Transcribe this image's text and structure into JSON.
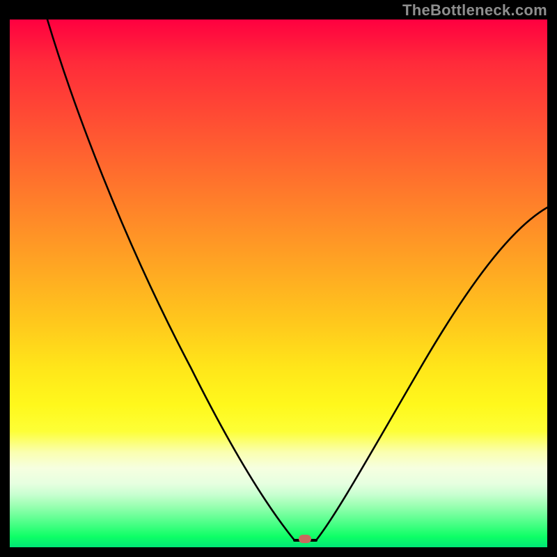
{
  "attribution": "TheBottleneck.com",
  "colors": {
    "page_bg": "#000000",
    "gradient_top": "#ff0040",
    "gradient_mid": "#ffe61a",
    "gradient_bottom": "#00e676",
    "curve": "#000000",
    "marker": "#c86a5e",
    "attrib_text": "#8e8e8e"
  },
  "chart_data": {
    "type": "line",
    "title": "",
    "xlabel": "",
    "ylabel": "",
    "xlim": [
      0,
      100
    ],
    "ylim": [
      0,
      100
    ],
    "series": [
      {
        "name": "left-branch",
        "x": [
          7,
          10,
          15,
          20,
          25,
          30,
          35,
          40,
          44,
          48,
          51,
          53
        ],
        "values": [
          100,
          89,
          74,
          62,
          52,
          42,
          33,
          24,
          15,
          8,
          3,
          0
        ]
      },
      {
        "name": "bottom-flat",
        "x": [
          53,
          57
        ],
        "values": [
          0,
          0
        ]
      },
      {
        "name": "right-branch",
        "x": [
          57,
          60,
          65,
          70,
          75,
          80,
          85,
          90,
          95,
          100
        ],
        "values": [
          0,
          3,
          9,
          17,
          25,
          34,
          43,
          51,
          58,
          64
        ]
      }
    ],
    "annotations": [
      {
        "name": "min-marker",
        "x": 55,
        "y": 0
      }
    ]
  }
}
